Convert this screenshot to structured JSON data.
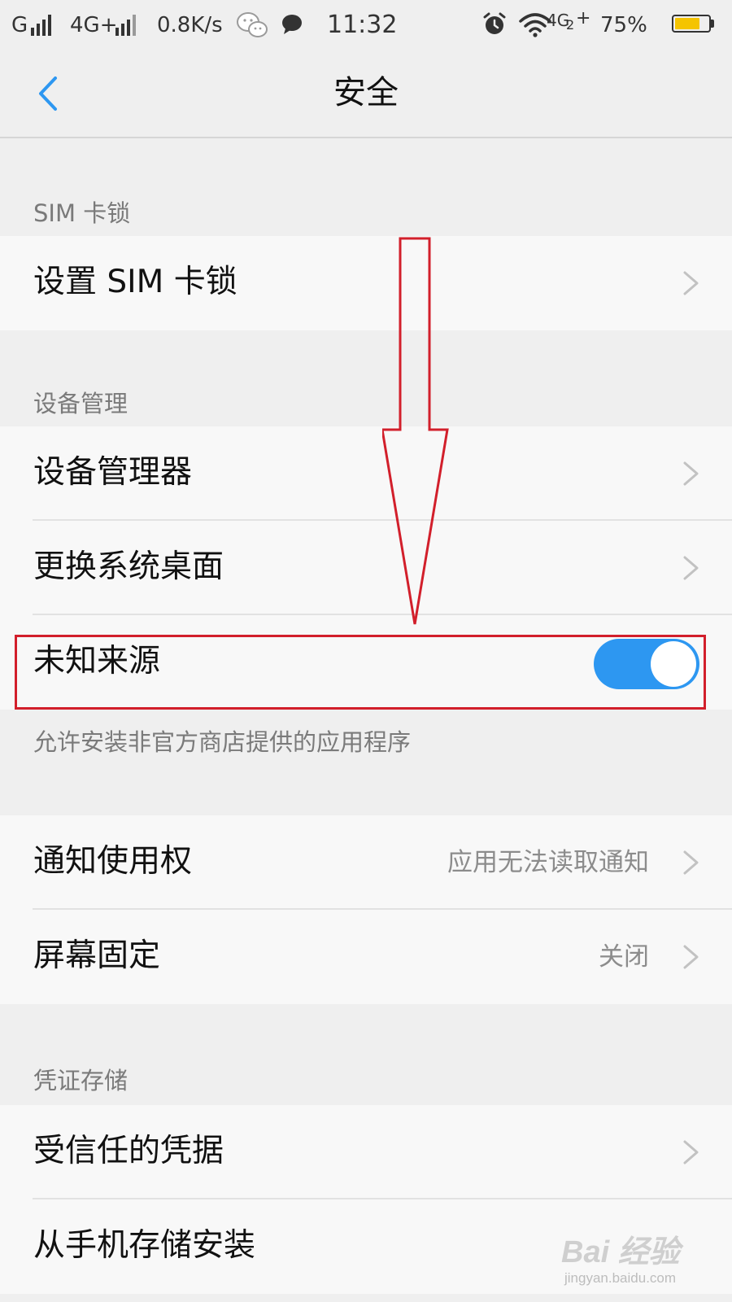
{
  "status_bar": {
    "carrier1": "G",
    "carrier2": "4G+",
    "net_speed": "0.8K/s",
    "time": "11:32",
    "network_type": "4G",
    "sim_slot": "2",
    "network_plus": "+",
    "battery_text": "75%",
    "battery_level": 0.75,
    "battery_color": "#f5c400",
    "icons": [
      "signal-icon",
      "signal-icon",
      "wechat-icon",
      "message-icon",
      "alarm-icon",
      "wifi-icon",
      "battery-icon"
    ]
  },
  "header": {
    "title": "安全",
    "back_icon": "chevron-left-icon"
  },
  "sections": {
    "sim": {
      "header": "SIM 卡锁",
      "items": [
        {
          "label": "设置 SIM 卡锁"
        }
      ]
    },
    "device": {
      "header": "设备管理",
      "items": [
        {
          "label": "设备管理器"
        },
        {
          "label": "更换系统桌面"
        },
        {
          "label": "未知来源",
          "toggle": true
        }
      ],
      "hint": "允许安装非官方商店提供的应用程序"
    },
    "misc": {
      "items": [
        {
          "label": "通知使用权",
          "value": "应用无法读取通知"
        },
        {
          "label": "屏幕固定",
          "value": "关闭"
        }
      ]
    },
    "credentials": {
      "header": "凭证存储",
      "items": [
        {
          "label": "受信任的凭据"
        },
        {
          "label": "从手机存储安装"
        }
      ]
    }
  },
  "overlay": {
    "annotation_color": "#d21f2b"
  },
  "watermark": {
    "brand": "Bai 经验",
    "url": "jingyan.baidu.com"
  },
  "colors": {
    "accent": "#2d97f1",
    "background": "#efefef",
    "row_background": "#f8f8f8"
  }
}
